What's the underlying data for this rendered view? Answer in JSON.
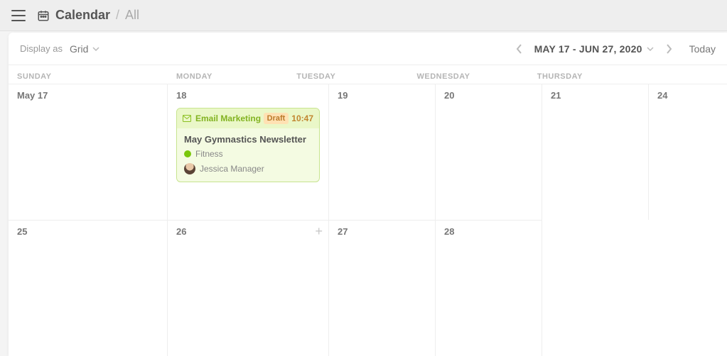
{
  "header": {
    "title": "Calendar",
    "separator": "/",
    "subtitle": "All"
  },
  "toolbar": {
    "display_as_label": "Display as",
    "view_mode": "Grid",
    "date_range": "MAY 17 - JUN 27, 2020",
    "today_label": "Today"
  },
  "day_headers": [
    "SUNDAY",
    "MONDAY",
    "TUESDAY",
    "WEDNESDAY",
    "THURSDAY"
  ],
  "dates": {
    "row0": [
      "May 17",
      "18",
      "19",
      "20",
      "21"
    ],
    "row1": [
      "24",
      "25",
      "26",
      "27",
      "28"
    ]
  },
  "event": {
    "category": "Email Marketing",
    "status": "Draft",
    "time": "10:47",
    "title": "May Gymnastics Newsletter",
    "tag_label": "Fitness",
    "tag_color": "#7ac70c",
    "assignee": "Jessica Manager"
  }
}
